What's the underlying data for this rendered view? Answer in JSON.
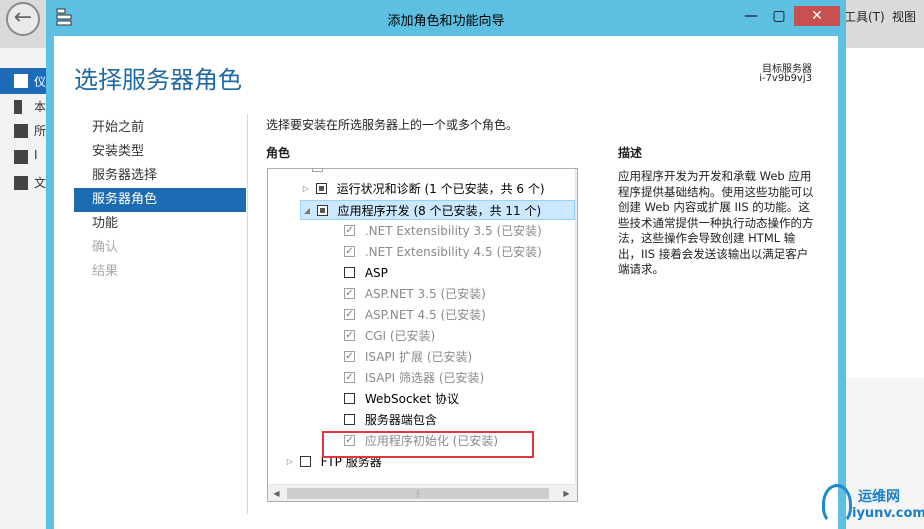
{
  "background_window": {
    "menu_tools": "工具(T)",
    "menu_view": "视图",
    "sidebar_items": [
      "仪",
      "本",
      "所",
      "I",
      "文"
    ]
  },
  "wizard": {
    "title": "添加角色和功能向导",
    "heading": "选择服务器角色",
    "destination_label": "目标服务器",
    "destination_value": "i-7v9b9vj3",
    "nav": [
      {
        "label": "开始之前",
        "state": "normal"
      },
      {
        "label": "安装类型",
        "state": "normal"
      },
      {
        "label": "服务器选择",
        "state": "normal"
      },
      {
        "label": "服务器角色",
        "state": "active"
      },
      {
        "label": "功能",
        "state": "normal"
      },
      {
        "label": "确认",
        "state": "disabled"
      },
      {
        "label": "结果",
        "state": "disabled"
      }
    ],
    "instruction": "选择要安装在所选服务器上的一个或多个角色。",
    "roles_label": "角色",
    "description_label": "描述",
    "description_text": "应用程序开发为开发和承载 Web 应用程序提供基础结构。使用这些功能可以创建 Web 内容或扩展 IIS 的功能。这些技术通常提供一种执行动态操作的方法，这些操作会导致创建 HTML 输出，IIS 接着会发送该输出以满足客户端请求。",
    "roles": [
      {
        "label": "运行状况和诊断 (1 个已安装，共 6 个)",
        "indent": 1,
        "expander": "collapsed",
        "check": "partial",
        "disabled": false,
        "selected": false
      },
      {
        "label": "应用程序开发 (8 个已安装，共 11 个)",
        "indent": 1,
        "expander": "expanded",
        "check": "partial",
        "disabled": false,
        "selected": true
      },
      {
        "label": ".NET Extensibility 3.5 (已安装)",
        "indent": 2,
        "expander": "none",
        "check": "checked",
        "disabled": true,
        "selected": false
      },
      {
        "label": ".NET Extensibility 4.5 (已安装)",
        "indent": 2,
        "expander": "none",
        "check": "checked",
        "disabled": true,
        "selected": false
      },
      {
        "label": "ASP",
        "indent": 2,
        "expander": "none",
        "check": "unchecked",
        "disabled": false,
        "selected": false
      },
      {
        "label": "ASP.NET 3.5 (已安装)",
        "indent": 2,
        "expander": "none",
        "check": "checked",
        "disabled": true,
        "selected": false
      },
      {
        "label": "ASP.NET 4.5 (已安装)",
        "indent": 2,
        "expander": "none",
        "check": "checked",
        "disabled": true,
        "selected": false
      },
      {
        "label": "CGI (已安装)",
        "indent": 2,
        "expander": "none",
        "check": "checked",
        "disabled": true,
        "selected": false
      },
      {
        "label": "ISAPI 扩展 (已安装)",
        "indent": 2,
        "expander": "none",
        "check": "checked",
        "disabled": true,
        "selected": false
      },
      {
        "label": "ISAPI 筛选器 (已安装)",
        "indent": 2,
        "expander": "none",
        "check": "checked",
        "disabled": true,
        "selected": false
      },
      {
        "label": "WebSocket 协议",
        "indent": 2,
        "expander": "none",
        "check": "unchecked",
        "disabled": false,
        "selected": false
      },
      {
        "label": "服务器端包含",
        "indent": 2,
        "expander": "none",
        "check": "unchecked",
        "disabled": false,
        "selected": false
      },
      {
        "label": "应用程序初始化 (已安装)",
        "indent": 2,
        "expander": "none",
        "check": "checked",
        "disabled": true,
        "selected": false
      },
      {
        "label": "FTP 服务器",
        "indent": 0,
        "expander": "collapsed",
        "check": "unchecked",
        "disabled": false,
        "selected": false
      }
    ]
  },
  "watermark": {
    "text_cn": "运维网",
    "text_en": "iyunv.com"
  },
  "colors": {
    "title_bar": "#5dbfe2",
    "accent": "#1d6bb2",
    "highlight_box": "#e0363d",
    "selection": "#cce8ff"
  }
}
